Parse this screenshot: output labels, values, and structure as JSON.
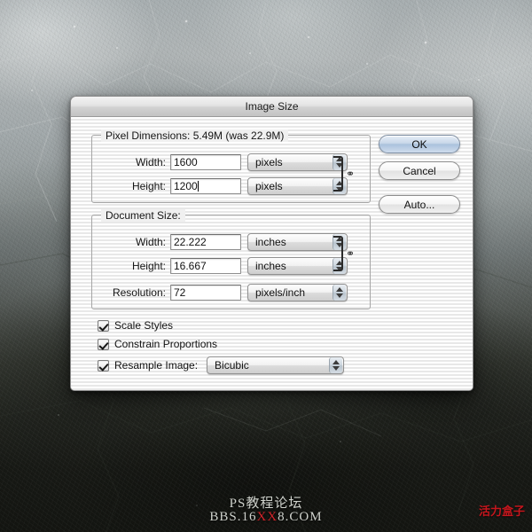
{
  "window": {
    "title": "Image Size"
  },
  "groups": {
    "pixel": {
      "label": "Pixel Dimensions:  5.49M (was 22.9M)",
      "rows": [
        {
          "label": "Width:",
          "value": "1600",
          "unit": "pixels",
          "has_caret": false
        },
        {
          "label": "Height:",
          "value": "1200",
          "unit": "pixels",
          "has_caret": true
        }
      ]
    },
    "document": {
      "label": "Document Size:",
      "rows": [
        {
          "label": "Width:",
          "value": "22.222",
          "unit": "inches"
        },
        {
          "label": "Height:",
          "value": "16.667",
          "unit": "inches"
        },
        {
          "label": "Resolution:",
          "value": "72",
          "unit": "pixels/inch"
        }
      ]
    }
  },
  "options": {
    "scale_styles": "Scale Styles",
    "constrain_proportions": "Constrain Proportions",
    "resample_image": "Resample Image:",
    "resample_method": "Bicubic"
  },
  "buttons": {
    "ok": "OK",
    "cancel": "Cancel",
    "auto": "Auto..."
  },
  "icons": {
    "chain": "⚭",
    "stepper_up": "▲",
    "stepper_down": "▼"
  },
  "watermark": {
    "chinese": "PS教程论坛",
    "url_pre": "BBS.16",
    "url_x": "XX",
    "url_post": "8.COM",
    "brand": "活力盒子",
    "accent_red": "#d4242a"
  }
}
